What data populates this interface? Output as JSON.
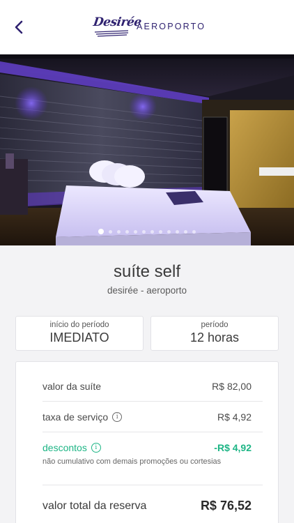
{
  "header": {
    "logo_text": "Desirée",
    "location": "AEROPORTO",
    "back_icon": "chevron-left-icon"
  },
  "gallery": {
    "dot_count": 12,
    "active_index": 0
  },
  "suite": {
    "name": "suíte self",
    "venue": "desirée - aeroporto"
  },
  "period": {
    "start_label": "início do período",
    "start_value": "IMEDIATO",
    "duration_label": "período",
    "duration_value": "12 horas"
  },
  "pricing": {
    "suite_label": "valor da suíte",
    "suite_value": "R$ 82,00",
    "fee_label": "taxa de serviço",
    "fee_value": "R$ 4,92",
    "discount_label": "descontos",
    "discount_value": "-R$ 4,92",
    "discount_note": "não cumulativo com demais promoções ou cortesias",
    "total_label": "valor total da reserva",
    "total_value": "R$ 76,52"
  },
  "colors": {
    "brand": "#2f2270",
    "discount": "#1db585",
    "background": "#f3f3f5"
  }
}
